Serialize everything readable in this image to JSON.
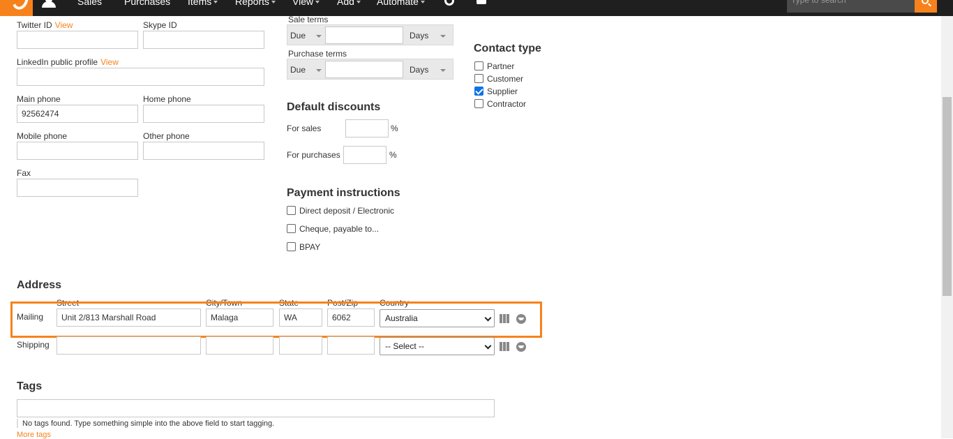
{
  "nav": {
    "items": [
      "Sales",
      "Purchases",
      "Items",
      "Reports",
      "View",
      "Add",
      "Automate"
    ],
    "search_placeholder": "Type to search"
  },
  "contact": {
    "twitter_label": "Twitter ID",
    "twitter_view": "View",
    "skype_label": "Skype ID",
    "linkedin_label": "LinkedIn public profile",
    "linkedin_view": "View",
    "main_phone_label": "Main phone",
    "main_phone_value": "92562474",
    "home_phone_label": "Home phone",
    "mobile_phone_label": "Mobile phone",
    "other_phone_label": "Other phone",
    "fax_label": "Fax"
  },
  "terms": {
    "sale_label": "Sale terms",
    "sale_due": "Due",
    "sale_days": "Days",
    "purchase_label": "Purchase terms",
    "purchase_due": "Due",
    "purchase_days": "Days"
  },
  "discounts": {
    "heading": "Default discounts",
    "sales_label": "For sales",
    "purchases_label": "For purchases",
    "percent": "%"
  },
  "payment": {
    "heading": "Payment instructions",
    "options": [
      "Direct deposit / Electronic",
      "Cheque, payable to...",
      "BPAY"
    ]
  },
  "contact_type": {
    "heading": "Contact type",
    "options": [
      {
        "label": "Partner",
        "checked": false
      },
      {
        "label": "Customer",
        "checked": false
      },
      {
        "label": "Supplier",
        "checked": true
      },
      {
        "label": "Contractor",
        "checked": false
      }
    ]
  },
  "address": {
    "heading": "Address",
    "col_street": "Street",
    "col_city": "City/Town",
    "col_state": "State",
    "col_post": "Post/Zip",
    "col_country": "Country",
    "mailing_label": "Mailing",
    "mailing_street": "Unit 2/813 Marshall Road",
    "mailing_city": "Malaga",
    "mailing_state": "WA",
    "mailing_post": "6062",
    "mailing_country": "Australia",
    "shipping_label": "Shipping",
    "shipping_country": "-- Select --"
  },
  "tags": {
    "heading": "Tags",
    "hint": "No tags found. Type something simple into the above field to start tagging.",
    "more": "More tags"
  },
  "colors": {
    "accent": "#f7821b",
    "topbar": "#1f1f1f",
    "checkbox": "#0b73e6"
  }
}
